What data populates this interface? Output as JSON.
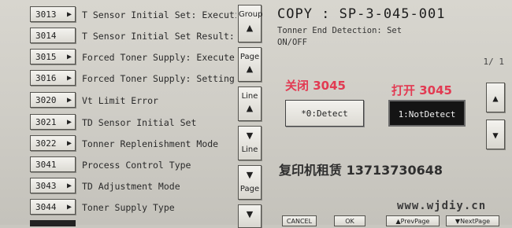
{
  "sp_list": [
    {
      "code": "3013",
      "label": "T Sensor Initial Set: Executio"
    },
    {
      "code": "3014",
      "label": "T Sensor Initial Set Result: D"
    },
    {
      "code": "3015",
      "label": "Forced Toner Supply: Execute"
    },
    {
      "code": "3016",
      "label": "Forced Toner Supply: Setting"
    },
    {
      "code": "3020",
      "label": "Vt Limit Error"
    },
    {
      "code": "3021",
      "label": "TD Sensor Initial Set"
    },
    {
      "code": "3022",
      "label": "Tonner Replenishment Mode"
    },
    {
      "code": "3041",
      "label": "Process Control Type"
    },
    {
      "code": "3043",
      "label": "TD Adjustment Mode"
    },
    {
      "code": "3044",
      "label": "Toner Supply Type"
    }
  ],
  "scroll": {
    "group_up": "Group",
    "page_up": "Page",
    "line_up": "Line",
    "line_down": "Line",
    "page_down": "Page"
  },
  "detail": {
    "title": "COPY : SP-3-045-001",
    "subtitle": "Tonner End Detection: Set",
    "mode": "ON/OFF",
    "page_indicator": "1/ 1",
    "anno_off": "关闭 3045",
    "anno_on": "打开 3045",
    "options": [
      {
        "label": "*0:Detect",
        "selected": false
      },
      {
        "label": "1:NotDetect",
        "selected": true
      }
    ]
  },
  "overlay": {
    "watermark": "复印机租赁 13713730648",
    "site": "www.wjdiy.cn"
  },
  "footer": {
    "cancel": "CANCEL",
    "ok": "OK",
    "prev_page": "PrevPage",
    "next_page": "NextPage"
  },
  "colors": {
    "annotation": "#e23a52",
    "selected_bg": "#141414"
  }
}
